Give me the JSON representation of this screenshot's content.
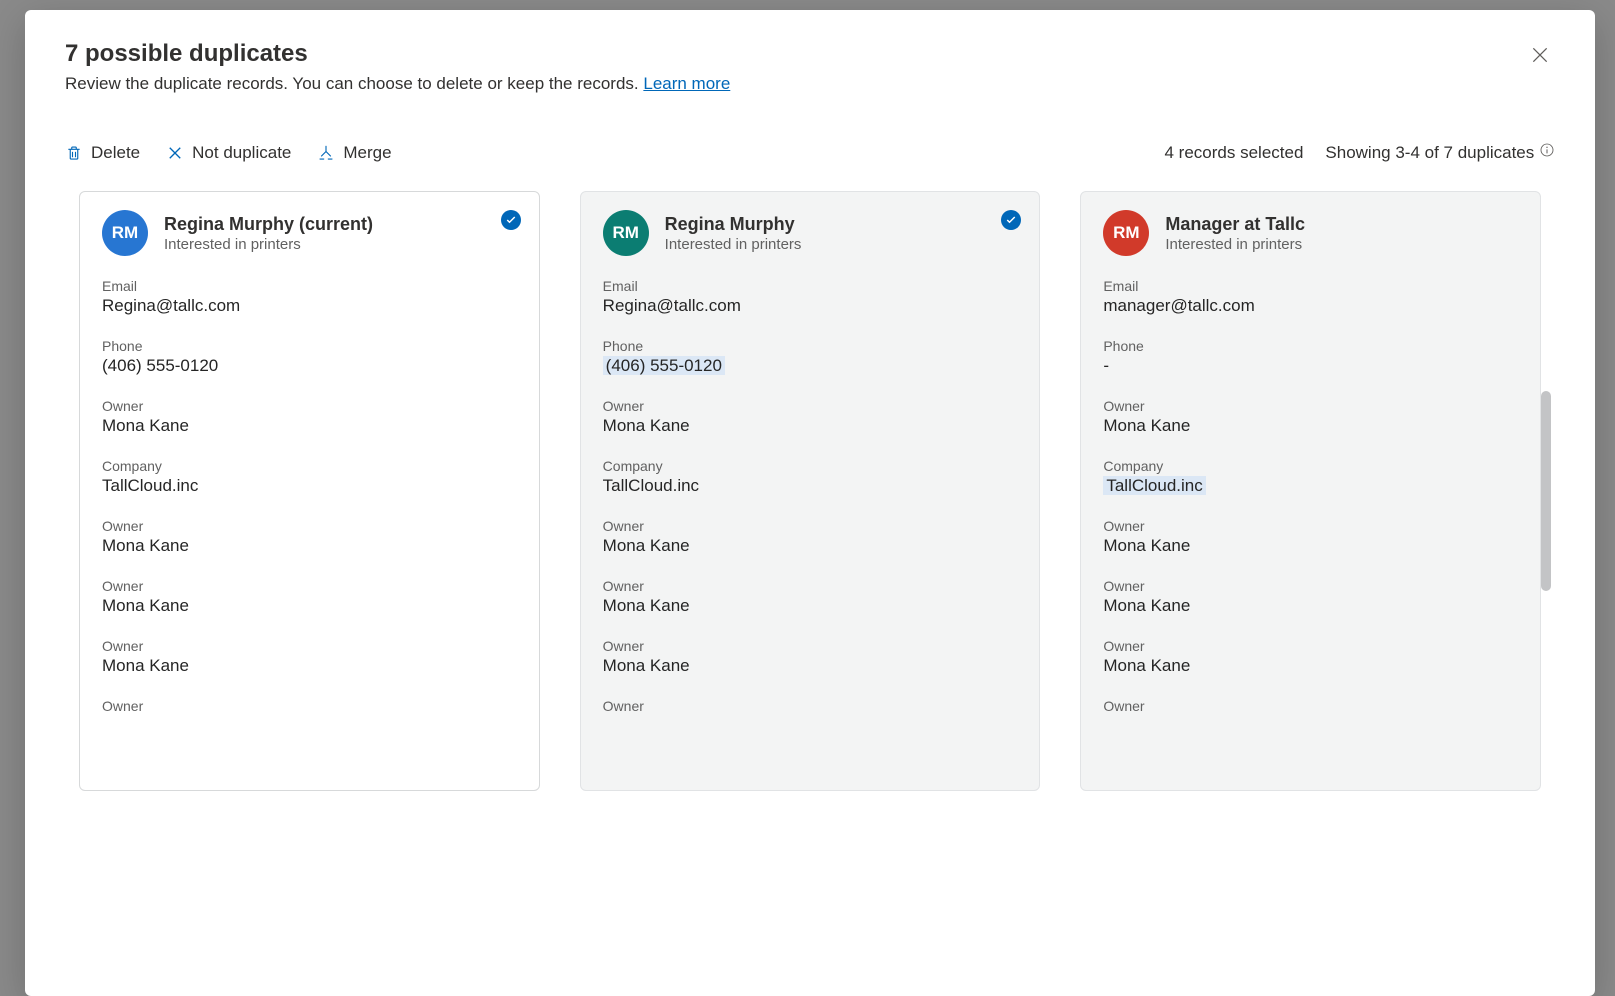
{
  "modal": {
    "title": "7 possible duplicates",
    "subtitle_prefix": "Review the duplicate records. You can choose to delete or keep the records. ",
    "learn_more": "Learn more"
  },
  "toolbar": {
    "delete": "Delete",
    "not_duplicate": "Not duplicate",
    "merge": "Merge"
  },
  "status": {
    "selected": "4 records selected",
    "showing": "Showing 3-4 of 7 duplicates"
  },
  "cards": [
    {
      "initials": "RM",
      "avatar_color": "blue",
      "name": "Regina Murphy (current)",
      "subtitle": "Interested in printers",
      "selected": true,
      "fields": [
        {
          "label": "Email",
          "value": "Regina@tallc.com",
          "highlight": false
        },
        {
          "label": "Phone",
          "value": "(406) 555-0120",
          "highlight": false
        },
        {
          "label": "Owner",
          "value": "Mona Kane",
          "highlight": false
        },
        {
          "label": "Company",
          "value": "TallCloud.inc",
          "highlight": false
        },
        {
          "label": "Owner",
          "value": "Mona Kane",
          "highlight": false
        },
        {
          "label": "Owner",
          "value": "Mona Kane",
          "highlight": false
        },
        {
          "label": "Owner",
          "value": "Mona Kane",
          "highlight": false
        },
        {
          "label": "Owner",
          "value": "",
          "highlight": false
        }
      ]
    },
    {
      "initials": "RM",
      "avatar_color": "teal",
      "name": "Regina Murphy",
      "subtitle": "Interested in printers",
      "selected": true,
      "fields": [
        {
          "label": "Email",
          "value": "Regina@tallc.com",
          "highlight": false
        },
        {
          "label": "Phone",
          "value": "(406) 555-0120",
          "highlight": true
        },
        {
          "label": "Owner",
          "value": "Mona Kane",
          "highlight": false
        },
        {
          "label": "Company",
          "value": "TallCloud.inc",
          "highlight": false
        },
        {
          "label": "Owner",
          "value": "Mona Kane",
          "highlight": false
        },
        {
          "label": "Owner",
          "value": "Mona Kane",
          "highlight": false
        },
        {
          "label": "Owner",
          "value": "Mona Kane",
          "highlight": false
        },
        {
          "label": "Owner",
          "value": "",
          "highlight": false
        }
      ]
    },
    {
      "initials": "RM",
      "avatar_color": "red",
      "name": "Manager at Tallc",
      "subtitle": "Interested in printers",
      "selected": false,
      "fields": [
        {
          "label": "Email",
          "value": "manager@tallc.com",
          "highlight": false
        },
        {
          "label": "Phone",
          "value": "-",
          "highlight": false
        },
        {
          "label": "Owner",
          "value": "Mona Kane",
          "highlight": false
        },
        {
          "label": "Company",
          "value": "TallCloud.inc",
          "highlight": true
        },
        {
          "label": "Owner",
          "value": "Mona Kane",
          "highlight": false
        },
        {
          "label": "Owner",
          "value": "Mona Kane",
          "highlight": false
        },
        {
          "label": "Owner",
          "value": "Mona Kane",
          "highlight": false
        },
        {
          "label": "Owner",
          "value": "",
          "highlight": false
        }
      ]
    }
  ]
}
